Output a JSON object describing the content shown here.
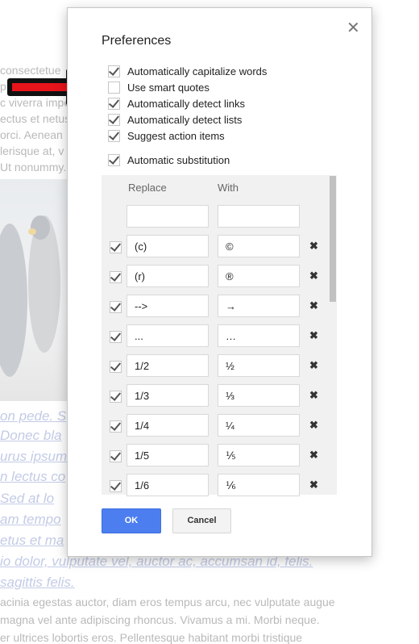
{
  "background": {
    "lines_top": [
      "consectetue",
      "p",
      "c viverra impe",
      "ectus et netus",
      "orci. Aenean",
      "lerisque at, v",
      "Ut nonummy."
    ],
    "links": [
      "on pede. S",
      "Donec bla",
      "urus ipsum",
      "n lectus co",
      "Sed at lo",
      "am tempo",
      "etus et ma",
      "io dolor, vulputate vel, auctor ac, accumsan id, felis.",
      "sagittis felis."
    ],
    "lines_bottom": [
      "acinia egestas auctor, diam eros tempus arcu, nec vulputate augue",
      "magna vel ante adipiscing rhoncus. Vivamus a mi. Morbi neque.",
      "er ultrices lobortis eros. Pellentesque habitant morbi tristique"
    ]
  },
  "dialog": {
    "title": "Preferences",
    "close_icon": "close-icon",
    "options": [
      {
        "label": "Automatically capitalize words",
        "checked": true
      },
      {
        "label": "Use smart quotes",
        "checked": false
      },
      {
        "label": "Automatically detect links",
        "checked": true
      },
      {
        "label": "Automatically detect lists",
        "checked": true
      },
      {
        "label": "Suggest action items",
        "checked": true
      },
      {
        "label": "Automatic substitution",
        "checked": true
      }
    ],
    "table": {
      "headers": {
        "replace": "Replace",
        "with": "With"
      },
      "new_row": {
        "replace": "",
        "with": ""
      },
      "rows": [
        {
          "replace": "(c)",
          "with": "©",
          "checked": true
        },
        {
          "replace": "(r)",
          "with": "®",
          "checked": true
        },
        {
          "replace": "-->",
          "with": "→",
          "checked": true
        },
        {
          "replace": "...",
          "with": "…",
          "checked": true
        },
        {
          "replace": "1/2",
          "with": "½",
          "checked": true
        },
        {
          "replace": "1/3",
          "with": "⅓",
          "checked": true
        },
        {
          "replace": "1/4",
          "with": "¼",
          "checked": true
        },
        {
          "replace": "1/5",
          "with": "⅕",
          "checked": true
        },
        {
          "replace": "1/6",
          "with": "⅙",
          "checked": true
        }
      ],
      "delete_symbol": "✖"
    },
    "ok_label": "OK",
    "cancel_label": "Cancel",
    "accent_color": "#4d7ef0"
  },
  "annotation": {
    "arrow_color": "#e8141b"
  }
}
